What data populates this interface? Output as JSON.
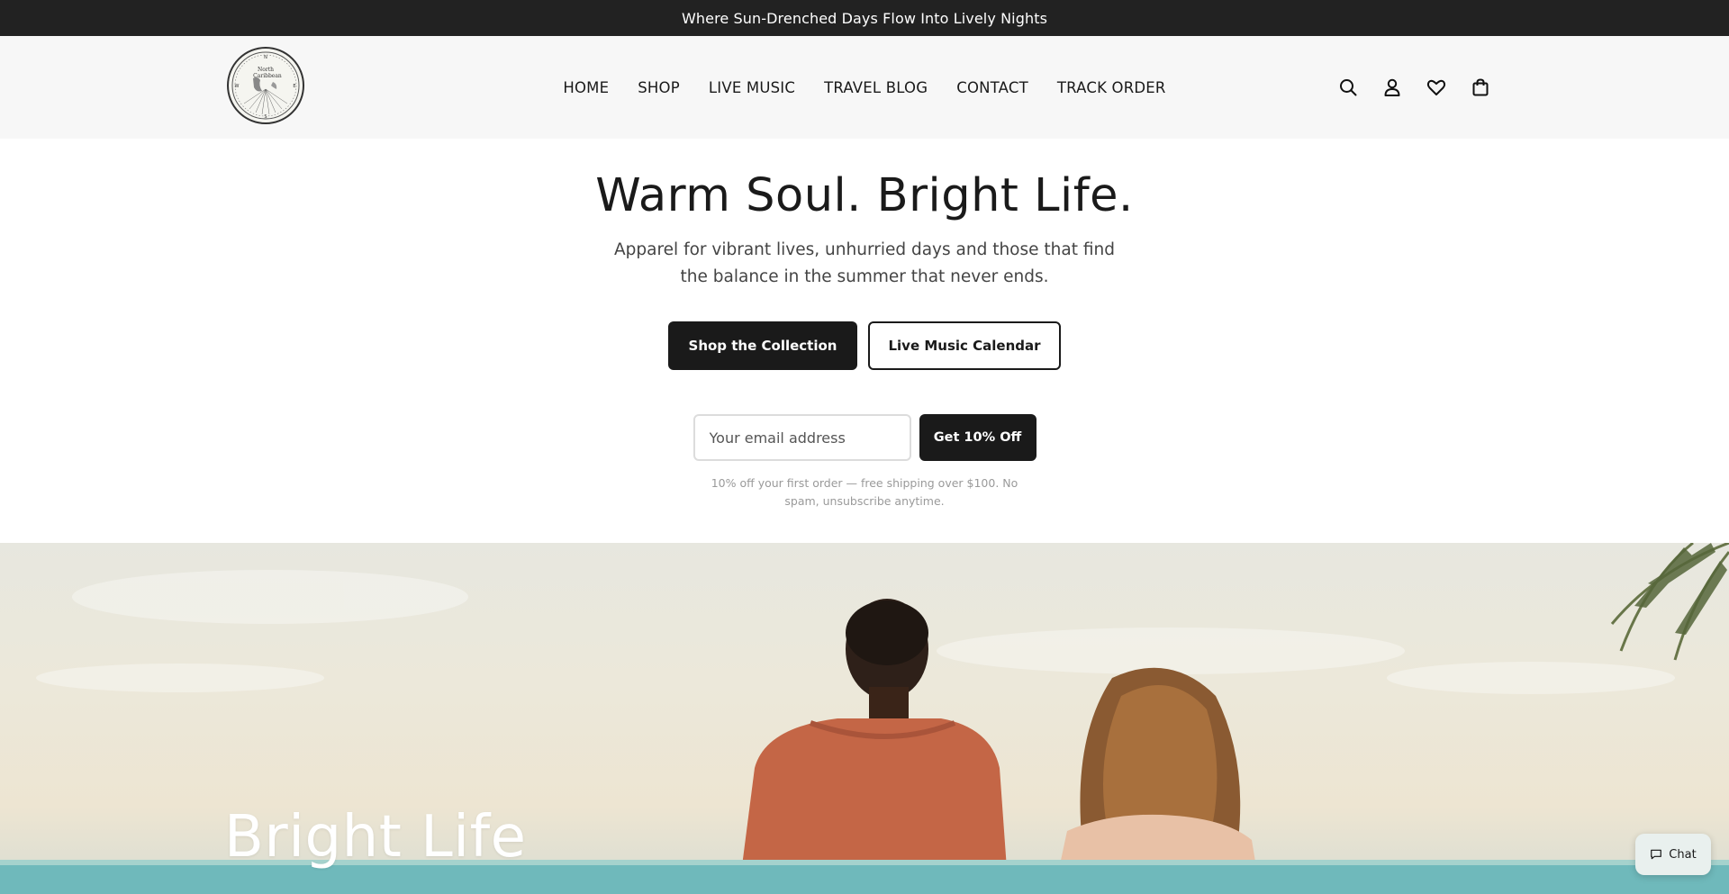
{
  "announcement": "Where Sun-Drenched Days Flow Into Lively Nights",
  "logo": {
    "text_line1": "North",
    "text_line2": "Caribbean"
  },
  "nav": {
    "items": [
      {
        "label": "HOME"
      },
      {
        "label": "SHOP"
      },
      {
        "label": "LIVE MUSIC"
      },
      {
        "label": "TRAVEL BLOG"
      },
      {
        "label": "CONTACT"
      },
      {
        "label": "TRACK ORDER"
      }
    ]
  },
  "header_icons": [
    "search-icon",
    "account-icon",
    "heart-icon",
    "bag-icon"
  ],
  "hero": {
    "title": "Warm Soul. Bright Life.",
    "subtitle": "Apparel for vibrant lives, unhurried days and those that find the balance in the summer that never ends.",
    "primary_cta": "Shop the Collection",
    "secondary_cta": "Live Music Calendar"
  },
  "signup": {
    "email_placeholder": "Your email address",
    "button_label": "Get 10% Off",
    "fine_print": "10% off your first order — free shipping over $100. No spam, unsubscribe anytime."
  },
  "banner": {
    "title": "Bright Life"
  },
  "chat": {
    "label": "Chat"
  },
  "colors": {
    "dark": "#1a1a1a",
    "announce_bg": "#222222",
    "header_bg": "#f7f7f7",
    "sea": "#5fb3b7",
    "shirt": "#c46646"
  }
}
